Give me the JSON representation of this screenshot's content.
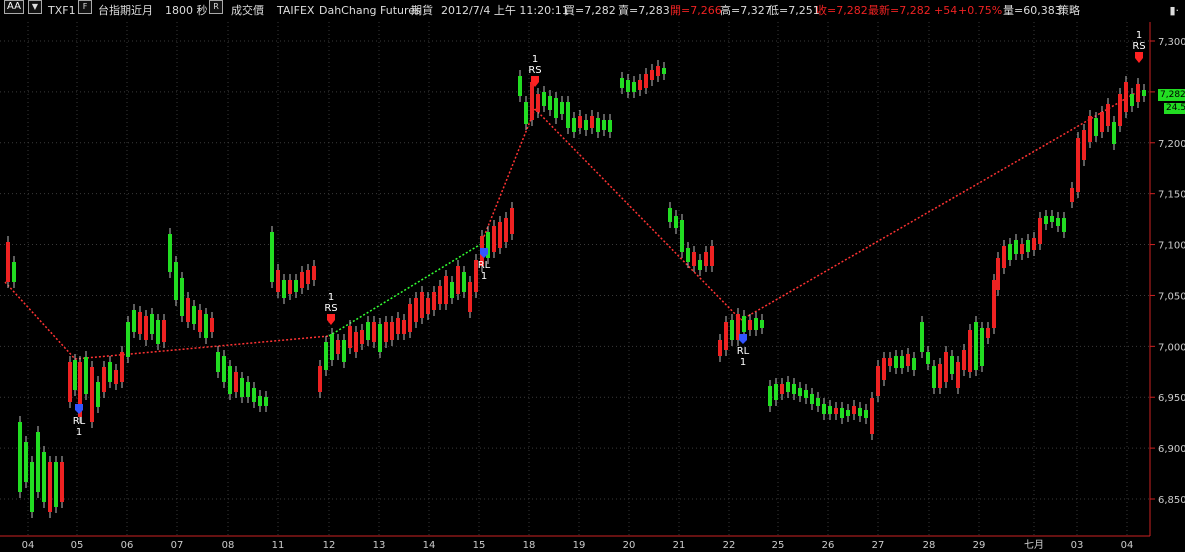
{
  "toolbar": {
    "style_button": "AA",
    "symbol": "TXF1",
    "symbol_name": "台指期近月",
    "interval": "1800 秒",
    "price_type": "成交價",
    "exchange": "TAIFEX",
    "broker": "DahChang Futures",
    "market": "期貨",
    "datetime": "2012/7/4 上午 11:20:11",
    "bid": "買=7,282",
    "ask": "賣=7,283",
    "open": "開=7,266",
    "high": "高=7,327",
    "low": "低=7,251",
    "close": "收=7,282",
    "last": "最新=7,282",
    "change": "+54",
    "change_pct": "+0.75%",
    "volume": "量=60,383",
    "strategy": "策略",
    "corner_icon": "bars-icon"
  },
  "colors": {
    "up": "#ee2222",
    "down": "#22dd22",
    "wick": "#bbbbbb",
    "grid": "#3a3a3a",
    "axis": "#cc2222",
    "zigzag_red": "#ff3333",
    "zigzag_green": "#33ff33",
    "signal_buy": "#3355ff",
    "signal_sell": "#ff2222"
  },
  "axis": {
    "y_ticks": [
      "7,300",
      "7,250",
      "7,200",
      "7,150",
      "7,100",
      "7,050",
      "7,000",
      "6,950",
      "6,900",
      "6,850"
    ],
    "x_ticks": [
      "04",
      "05",
      "06",
      "07",
      "08",
      "11",
      "12",
      "13",
      "14",
      "15",
      "18",
      "19",
      "20",
      "21",
      "22",
      "25",
      "26",
      "27",
      "28",
      "29",
      "七月",
      "03",
      "04"
    ]
  },
  "badges": {
    "price": "7,282",
    "secondary": "24.5"
  },
  "signals": [
    {
      "label": "RL",
      "count": "1",
      "type": "buy"
    },
    {
      "label": "RS",
      "count": "1",
      "type": "sell"
    },
    {
      "label": "RL",
      "count": "1",
      "type": "buy"
    },
    {
      "label": "RS",
      "count": "1",
      "type": "sell"
    },
    {
      "label": "RL",
      "count": "1",
      "type": "buy"
    },
    {
      "label": "RS",
      "count": "1",
      "type": "sell"
    }
  ],
  "chart_data": {
    "type": "candlestick",
    "ylim": [
      6830,
      7345
    ],
    "x": [
      "04",
      "05",
      "06",
      "07",
      "08",
      "11",
      "12",
      "13",
      "14",
      "15",
      "18",
      "19",
      "20",
      "21",
      "22",
      "25",
      "26",
      "27",
      "28",
      "29",
      "七月",
      "03",
      "04"
    ],
    "anchors": [
      {
        "x": "04",
        "y": 7080
      },
      {
        "x": "05",
        "y": 6990
      },
      {
        "x": "12",
        "y": 7022
      },
      {
        "x": "15",
        "y": 7120
      },
      {
        "x": "18",
        "y": 7265
      },
      {
        "x": "22",
        "y": 7025
      },
      {
        "x": "04",
        "y": 7290
      }
    ]
  }
}
